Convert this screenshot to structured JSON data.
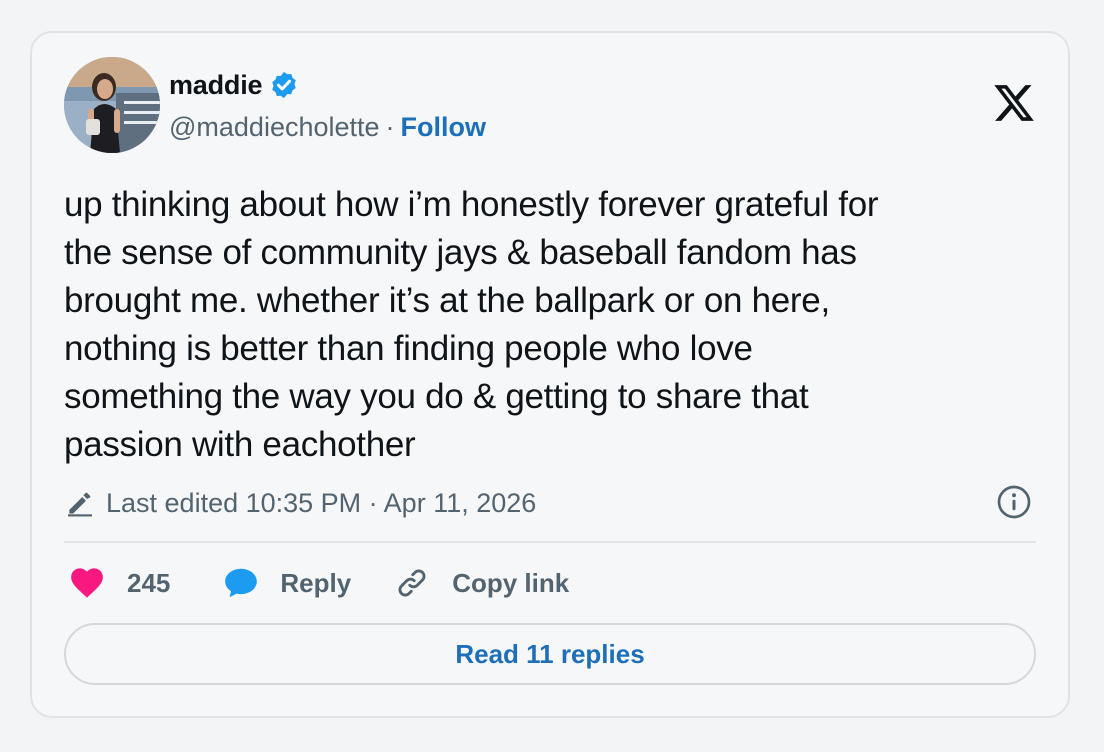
{
  "author": {
    "display_name": "maddie",
    "handle": "@maddiecholette",
    "separator": "·",
    "follow_label": "Follow",
    "verified": true
  },
  "tweet": {
    "lines": [
      "up thinking about how i’m honestly forever grateful for",
      "the sense of community jays & baseball fandom has",
      "brought me. whether it’s at the ballpark or on here,",
      "nothing is better than finding people who love",
      "something the way you do & getting to share that",
      "passion with eachother"
    ],
    "edited_label": "Last edited 10:35 PM · Apr 11, 2026"
  },
  "actions": {
    "like_count": "245",
    "reply_label": "Reply",
    "copy_link_label": "Copy link",
    "read_replies_label": "Read 11 replies"
  },
  "icons": {
    "logo": "x-logo-icon",
    "verified": "verified-badge-icon",
    "edit": "pencil-icon",
    "info": "info-icon",
    "like": "heart-icon",
    "reply": "speech-bubble-icon",
    "link": "link-icon"
  },
  "colors": {
    "accent": "#1d6fb8",
    "heart": "#f91880",
    "reply_bubble": "#1d9bf0",
    "text": "#0f1419",
    "muted": "#536471"
  }
}
